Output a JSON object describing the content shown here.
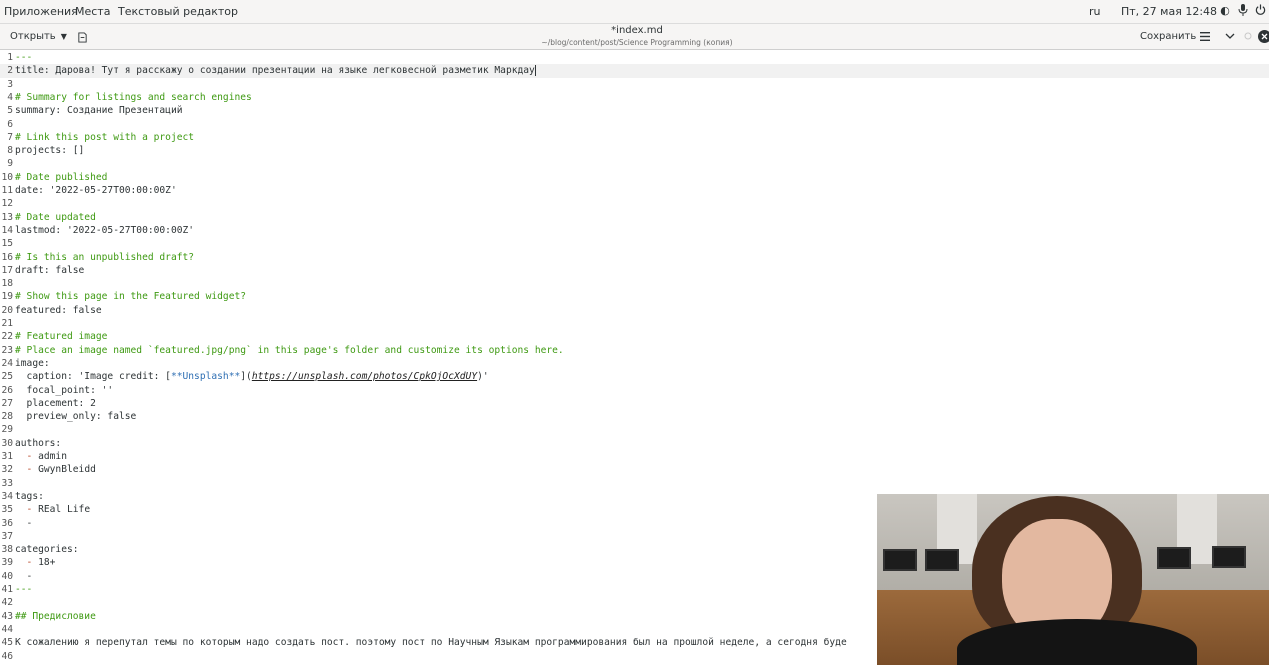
{
  "topbar": {
    "apps_label": "Приложения",
    "places_label": "Места",
    "app_name": "Текстовый редактор",
    "lang": "ru",
    "datetime": "Пт, 27 мая  12:48"
  },
  "header": {
    "open_label": "Открыть",
    "doc_title": "*index.md",
    "doc_path": "~/blog/content/post/Science Programming (копия)",
    "save_label": "Сохранить"
  },
  "editor": {
    "current_line": 2,
    "lines": [
      {
        "n": "1",
        "segs": [
          {
            "t": "---",
            "c": "c-green"
          }
        ]
      },
      {
        "n": "2",
        "segs": [
          {
            "t": "title: Дарова! Тут я расскажу о создании презентации на языке легковесной разметик Маркдау",
            "c": ""
          }
        ],
        "cursor": true
      },
      {
        "n": "3",
        "segs": []
      },
      {
        "n": "4",
        "segs": [
          {
            "t": "# Summary for listings and search engines",
            "c": "c-comment"
          }
        ]
      },
      {
        "n": "5",
        "segs": [
          {
            "t": "summary: Создание Презентаций",
            "c": ""
          }
        ]
      },
      {
        "n": "6",
        "segs": []
      },
      {
        "n": "7",
        "segs": [
          {
            "t": "# Link this post with a project",
            "c": "c-comment"
          }
        ]
      },
      {
        "n": "8",
        "segs": [
          {
            "t": "projects: []",
            "c": ""
          }
        ]
      },
      {
        "n": "9",
        "segs": []
      },
      {
        "n": "10",
        "segs": [
          {
            "t": "# Date published",
            "c": "c-comment"
          }
        ]
      },
      {
        "n": "11",
        "segs": [
          {
            "t": "date: '2022-05-27T00:00:00Z'",
            "c": ""
          }
        ]
      },
      {
        "n": "12",
        "segs": []
      },
      {
        "n": "13",
        "segs": [
          {
            "t": "# Date updated",
            "c": "c-comment"
          }
        ]
      },
      {
        "n": "14",
        "segs": [
          {
            "t": "lastmod: '2022-05-27T00:00:00Z'",
            "c": ""
          }
        ]
      },
      {
        "n": "15",
        "segs": []
      },
      {
        "n": "16",
        "segs": [
          {
            "t": "# Is this an unpublished draft?",
            "c": "c-comment"
          }
        ]
      },
      {
        "n": "17",
        "segs": [
          {
            "t": "draft: false",
            "c": ""
          }
        ]
      },
      {
        "n": "18",
        "segs": []
      },
      {
        "n": "19",
        "segs": [
          {
            "t": "# Show this page in the Featured widget?",
            "c": "c-comment"
          }
        ]
      },
      {
        "n": "20",
        "segs": [
          {
            "t": "featured: false",
            "c": ""
          }
        ]
      },
      {
        "n": "21",
        "segs": []
      },
      {
        "n": "22",
        "segs": [
          {
            "t": "# Featured image",
            "c": "c-comment"
          }
        ]
      },
      {
        "n": "23",
        "segs": [
          {
            "t": "# Place an image named `featured.jpg/png` in this page's folder and customize its options here.",
            "c": "c-comment"
          }
        ]
      },
      {
        "n": "24",
        "segs": [
          {
            "t": "image:",
            "c": ""
          }
        ]
      },
      {
        "n": "25",
        "segs": [
          {
            "t": "  caption: 'Image credit: [",
            "c": ""
          },
          {
            "t": "**Unsplash**",
            "c": "c-link"
          },
          {
            "t": "](",
            "c": ""
          },
          {
            "t": "https://unsplash.com/photos/CpkOjOcXdUY",
            "c": "c-url"
          },
          {
            "t": ")'",
            "c": ""
          }
        ]
      },
      {
        "n": "26",
        "segs": [
          {
            "t": "  focal_point: ''",
            "c": ""
          }
        ]
      },
      {
        "n": "27",
        "segs": [
          {
            "t": "  placement: 2",
            "c": ""
          }
        ]
      },
      {
        "n": "28",
        "segs": [
          {
            "t": "  preview_only: false",
            "c": ""
          }
        ]
      },
      {
        "n": "29",
        "segs": []
      },
      {
        "n": "30",
        "segs": [
          {
            "t": "authors:",
            "c": ""
          }
        ]
      },
      {
        "n": "31",
        "segs": [
          {
            "t": "  - ",
            "c": "c-dash"
          },
          {
            "t": "admin",
            "c": ""
          }
        ]
      },
      {
        "n": "32",
        "segs": [
          {
            "t": "  - ",
            "c": "c-dash"
          },
          {
            "t": "GwynBleidd",
            "c": ""
          }
        ]
      },
      {
        "n": "33",
        "segs": []
      },
      {
        "n": "34",
        "segs": [
          {
            "t": "tags:",
            "c": ""
          }
        ]
      },
      {
        "n": "35",
        "segs": [
          {
            "t": "  - ",
            "c": "c-dash"
          },
          {
            "t": "REal Life",
            "c": ""
          }
        ]
      },
      {
        "n": "36",
        "segs": [
          {
            "t": "  -",
            "c": ""
          }
        ]
      },
      {
        "n": "37",
        "segs": []
      },
      {
        "n": "38",
        "segs": [
          {
            "t": "categories:",
            "c": ""
          }
        ]
      },
      {
        "n": "39",
        "segs": [
          {
            "t": "  - ",
            "c": "c-dash"
          },
          {
            "t": "18+",
            "c": ""
          }
        ]
      },
      {
        "n": "40",
        "segs": [
          {
            "t": "  -",
            "c": ""
          }
        ]
      },
      {
        "n": "41",
        "segs": [
          {
            "t": "---",
            "c": "c-green"
          }
        ]
      },
      {
        "n": "42",
        "segs": []
      },
      {
        "n": "43",
        "segs": [
          {
            "t": "## Предисловие",
            "c": "c-green"
          }
        ]
      },
      {
        "n": "44",
        "segs": []
      },
      {
        "n": "45",
        "segs": [
          {
            "t": "К сожалению я перепутал темы по которым надо создать пост. поэтому пост по Научным Языкам программирования был на прошлой неделе, а сегодня буде",
            "c": ""
          }
        ]
      },
      {
        "n": "46",
        "segs": []
      }
    ]
  },
  "icons": {
    "newdoc": "new-document-icon",
    "menu": "hamburger-menu-icon",
    "minimize": "minimize-icon",
    "maximize": "maximize-icon",
    "close": "close-icon",
    "sound": "volume-icon",
    "mic": "microphone-icon",
    "power": "power-icon",
    "contrast": "contrast-icon"
  }
}
